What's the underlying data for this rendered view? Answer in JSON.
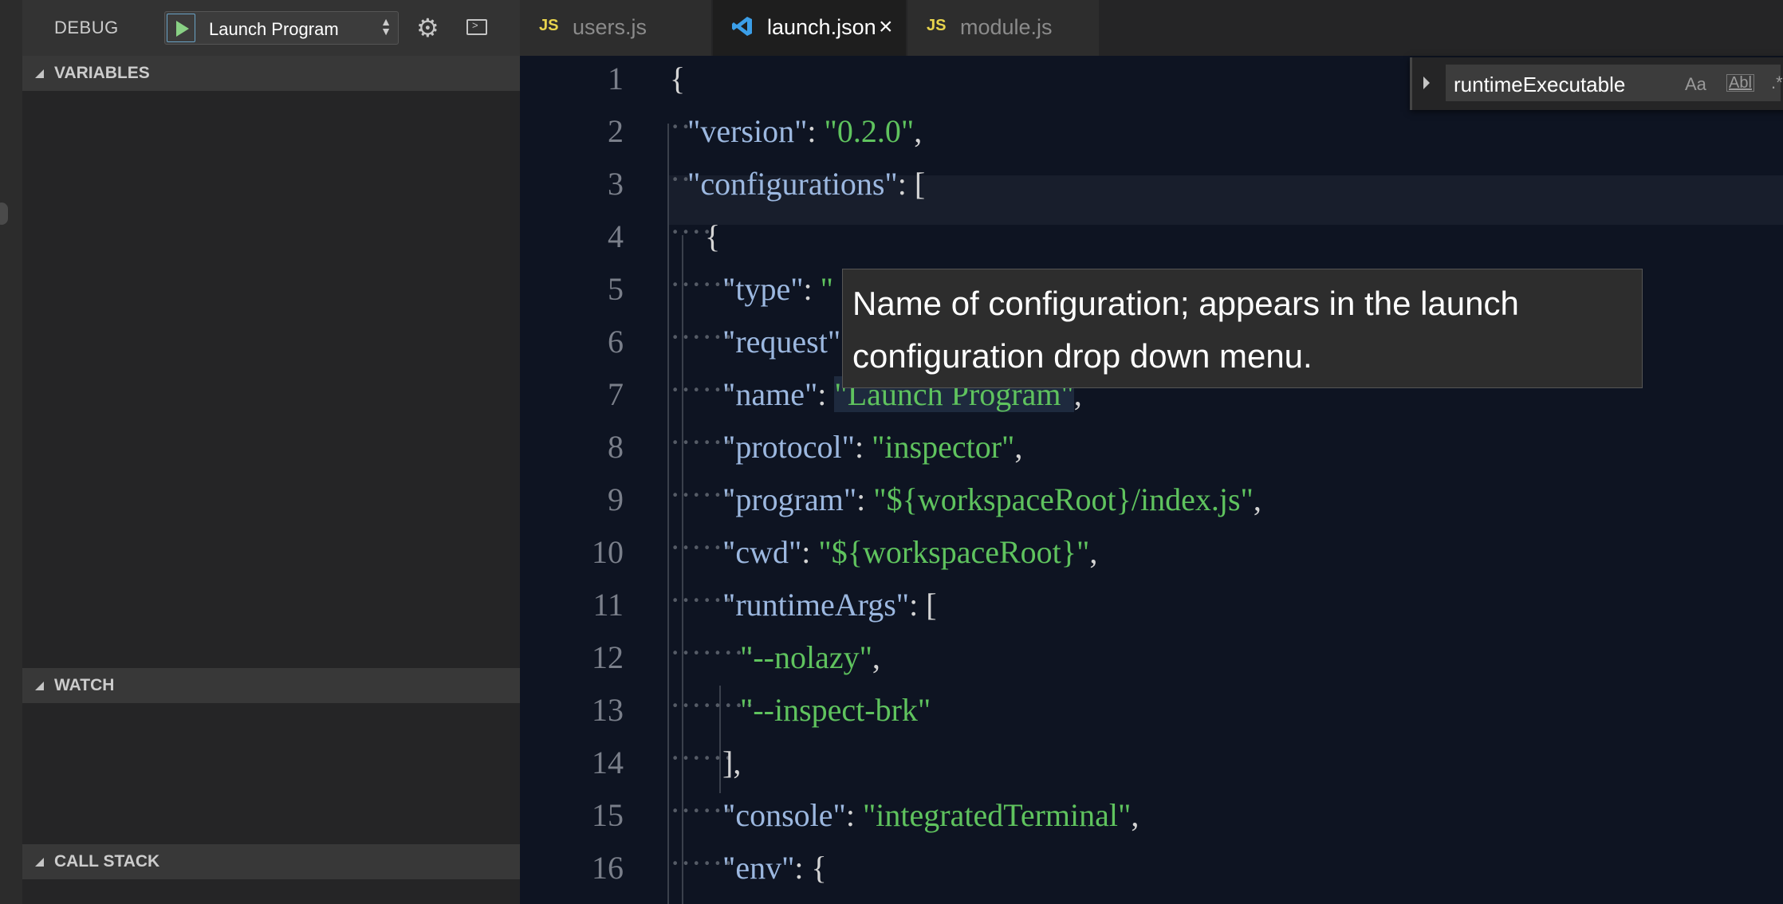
{
  "debug": {
    "title": "DEBUG",
    "configuration": "Launch Program",
    "sections": [
      "VARIABLES",
      "WATCH",
      "CALL STACK"
    ]
  },
  "tabs": [
    {
      "icon": "JS",
      "label": "users.js",
      "active": false
    },
    {
      "icon": "vscode-icon",
      "label": "launch.json",
      "active": true,
      "close": "×"
    },
    {
      "icon": "JS",
      "label": "module.js",
      "active": false
    }
  ],
  "find": {
    "value": "runtimeExecutable",
    "match_case": "Aa",
    "whole_word": "Abl",
    "regex": ".*"
  },
  "hover": {
    "text": "Name of configuration; appears in the launch configuration drop down menu."
  },
  "editor": {
    "lines": [
      {
        "num": "1",
        "guide": "",
        "segs": [
          [
            "p",
            "{"
          ]
        ]
      },
      {
        "num": "2",
        "guide": "··",
        "segs": [
          [
            "k",
            "\"version\""
          ],
          [
            "p",
            ": "
          ],
          [
            "s",
            "\"0.2.0\""
          ],
          [
            "p",
            ","
          ]
        ]
      },
      {
        "num": "3",
        "guide": "··",
        "segs": [
          [
            "k",
            "\"configurations\""
          ],
          [
            "p",
            ": ["
          ]
        ]
      },
      {
        "num": "4",
        "guide": "····",
        "segs": [
          [
            "p",
            "{"
          ]
        ]
      },
      {
        "num": "5",
        "guide": "······",
        "segs": [
          [
            "k",
            "\"type\""
          ],
          [
            "p",
            ": "
          ],
          [
            "s",
            "\""
          ]
        ]
      },
      {
        "num": "6",
        "guide": "······",
        "segs": [
          [
            "k",
            "\"request\""
          ]
        ]
      },
      {
        "num": "7",
        "guide": "······",
        "segs": [
          [
            "k",
            "\"name\""
          ],
          [
            "p",
            ": "
          ],
          [
            "h",
            "\"Launch Program\""
          ],
          [
            "p",
            ","
          ]
        ]
      },
      {
        "num": "8",
        "guide": "······",
        "segs": [
          [
            "k",
            "\"protocol\""
          ],
          [
            "p",
            ": "
          ],
          [
            "s",
            "\"inspector\""
          ],
          [
            "p",
            ","
          ]
        ]
      },
      {
        "num": "9",
        "guide": "······",
        "segs": [
          [
            "k",
            "\"program\""
          ],
          [
            "p",
            ": "
          ],
          [
            "s",
            "\"${workspaceRoot}/index.js\""
          ],
          [
            "p",
            ","
          ]
        ]
      },
      {
        "num": "10",
        "guide": "······",
        "segs": [
          [
            "k",
            "\"cwd\""
          ],
          [
            "p",
            ": "
          ],
          [
            "s",
            "\"${workspaceRoot}\""
          ],
          [
            "p",
            ","
          ]
        ]
      },
      {
        "num": "11",
        "guide": "······",
        "segs": [
          [
            "k",
            "\"runtimeArgs\""
          ],
          [
            "p",
            ": ["
          ]
        ]
      },
      {
        "num": "12",
        "guide": "········",
        "segs": [
          [
            "s",
            "\"--nolazy\""
          ],
          [
            "p",
            ","
          ]
        ]
      },
      {
        "num": "13",
        "guide": "········",
        "segs": [
          [
            "s",
            "\"--inspect-brk\""
          ]
        ]
      },
      {
        "num": "14",
        "guide": "······",
        "segs": [
          [
            "p",
            "],"
          ]
        ]
      },
      {
        "num": "15",
        "guide": "······",
        "segs": [
          [
            "k",
            "\"console\""
          ],
          [
            "p",
            ": "
          ],
          [
            "s",
            "\"integratedTerminal\""
          ],
          [
            "p",
            ","
          ]
        ]
      },
      {
        "num": "16",
        "guide": "······",
        "segs": [
          [
            "k",
            "\"env\""
          ],
          [
            "p",
            ": {"
          ]
        ]
      }
    ]
  }
}
